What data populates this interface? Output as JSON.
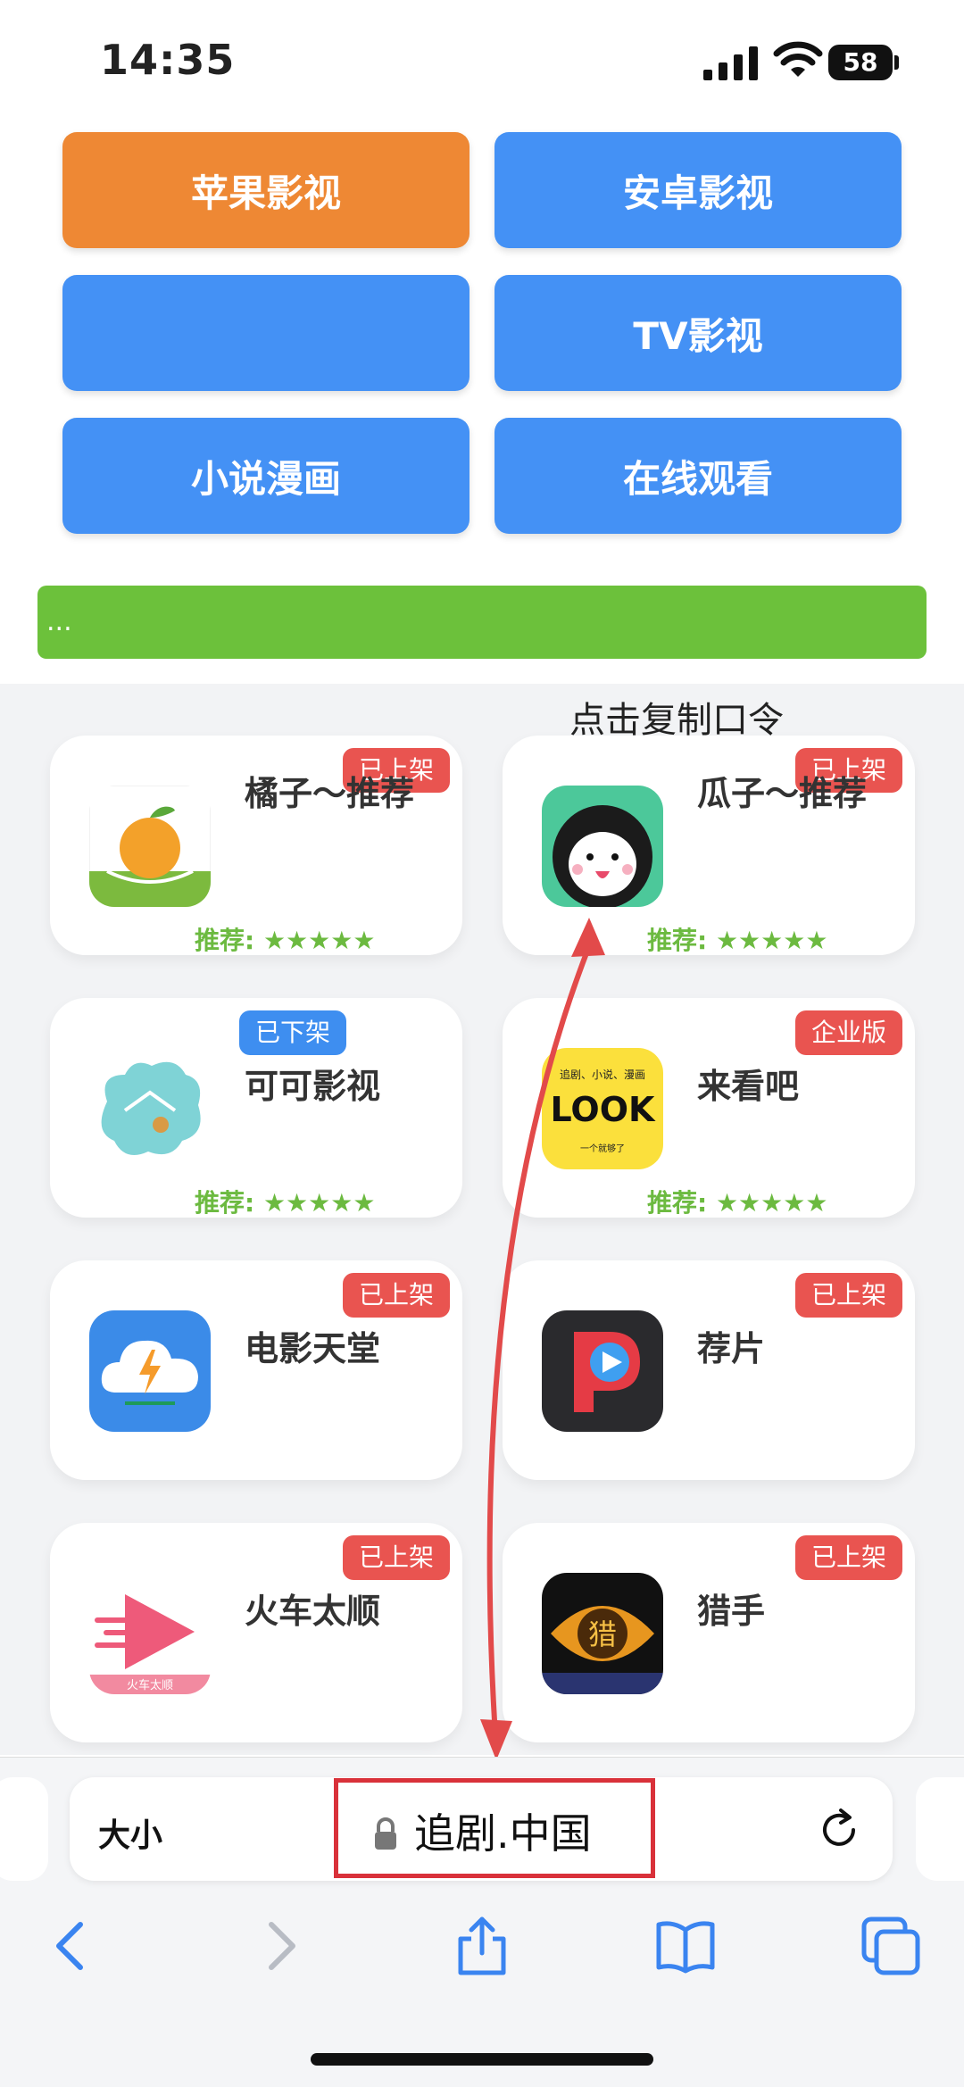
{
  "status": {
    "time": "14:35",
    "battery": "58"
  },
  "nav_buttons": [
    {
      "label": "苹果影视",
      "color": "#ee8834"
    },
    {
      "label": "安卓影视",
      "color": "#4491f5"
    },
    {
      "label": "",
      "color": "#4491f5"
    },
    {
      "label": "TV影视",
      "color": "#4491f5"
    },
    {
      "label": "小说漫画",
      "color": "#4491f5"
    },
    {
      "label": "在线观看",
      "color": "#4491f5"
    }
  ],
  "green_bar": {
    "text": "..."
  },
  "copy_hint": "点击复制口令",
  "apps": [
    {
      "name": "橘子～推荐",
      "badge": "已上架",
      "rating_label": "推荐:",
      "stars": "★★★★★",
      "icon": "orange-icon"
    },
    {
      "name": "瓜子～推荐",
      "badge": "已上架",
      "rating_label": "推荐:",
      "stars": "★★★★★",
      "icon": "melon-seed-icon"
    },
    {
      "name": "可可影视",
      "badge": "已下架",
      "rating_label": "推荐:",
      "stars": "★★★★★",
      "icon": "keke-icon"
    },
    {
      "name": "来看吧",
      "badge": "企业版",
      "rating_label": "推荐:",
      "stars": "★★★★★",
      "icon": "look-icon",
      "icon_caption_top": "追剧、小说、漫画",
      "icon_caption_main": "LOOK",
      "icon_caption_bottom": "一个就够了"
    },
    {
      "name": "电影天堂",
      "badge": "已上架",
      "icon": "cloud-lightning-icon"
    },
    {
      "name": "荐片",
      "badge": "已上架",
      "icon": "p-logo-icon"
    },
    {
      "name": "火车太顺",
      "badge": "已上架",
      "icon": "train-play-icon",
      "icon_caption": "火车太顺"
    },
    {
      "name": "猎手",
      "badge": "已上架",
      "icon": "hunter-eye-icon",
      "icon_caption": "猎"
    }
  ],
  "browser": {
    "text_size_label": "大小",
    "url": "追剧.中国",
    "highlight_color": "#d9313a"
  },
  "toolbar_icons": [
    "back-icon",
    "forward-icon",
    "share-icon",
    "bookmarks-icon",
    "tabs-icon"
  ]
}
